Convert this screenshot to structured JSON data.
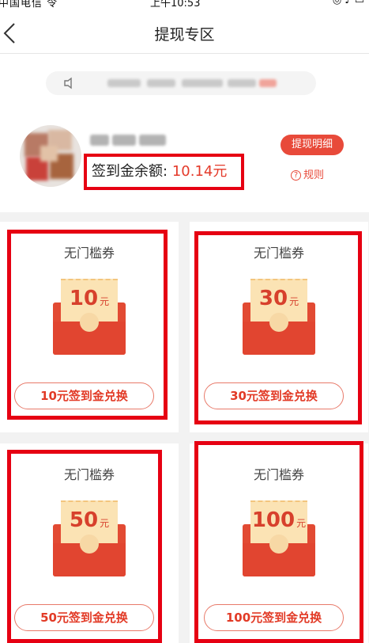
{
  "status_bar": {
    "carrier": "中国电信 令",
    "time": "上午10:53",
    "battery": "◎ ♪ ▭"
  },
  "nav": {
    "title": "提现专区",
    "back_icon": "chevron-left-icon"
  },
  "account": {
    "balance_label": "签到金余额:",
    "balance_value": "10.14元",
    "detail_button": "提现明细",
    "rules_icon": "?",
    "rules_label": "规则"
  },
  "coupons": [
    {
      "title": "无门槛券",
      "amount": "10",
      "unit": "元",
      "button": "10元签到金兑换"
    },
    {
      "title": "无门槛券",
      "amount": "30",
      "unit": "元",
      "button": "30元签到金兑换"
    },
    {
      "title": "无门槛券",
      "amount": "50",
      "unit": "元",
      "button": "50元签到金兑换"
    },
    {
      "title": "无门槛券",
      "amount": "100",
      "unit": "元",
      "button": "100元签到金兑换"
    }
  ],
  "colors": {
    "accent": "#e84a3a",
    "highlight": "#e60012",
    "envelope": "#e24a33",
    "paper": "#fbe3b4"
  }
}
